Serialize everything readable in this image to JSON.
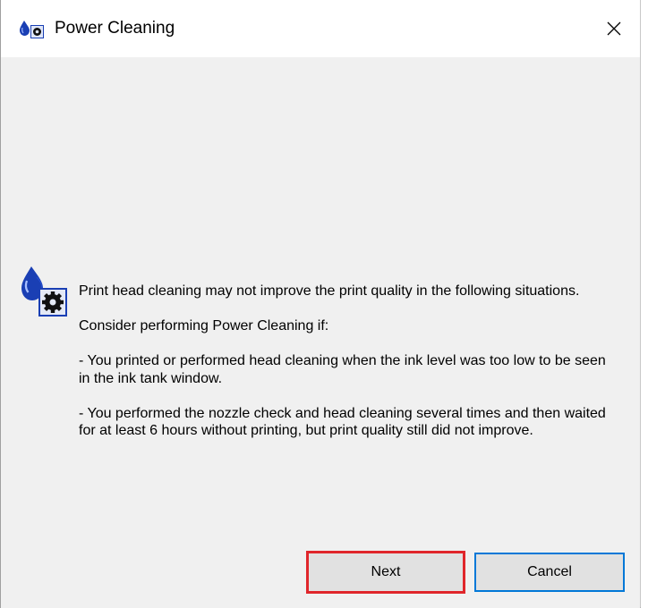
{
  "window": {
    "title": "Power Cleaning",
    "close_glyph": "✕",
    "title_icon": "ink-cleaning-icon"
  },
  "message": {
    "icon": "ink-cleaning-icon",
    "paragraphs": [
      "Print head cleaning may not improve the print quality in the following situations.",
      "Consider performing Power Cleaning if:",
      "- You printed or performed head cleaning when the ink level was too low to be seen in the ink tank window.",
      "- You performed the nozzle check and head cleaning several times and then waited for at least 6 hours without printing, but print quality still did not improve."
    ]
  },
  "buttons": {
    "next_label": "Next",
    "cancel_label": "Cancel"
  },
  "colors": {
    "highlight": "#e0262b",
    "focus_border": "#0078d7",
    "dialog_bg": "#f0f0f0",
    "ink_blue": "#1a3fb4"
  }
}
